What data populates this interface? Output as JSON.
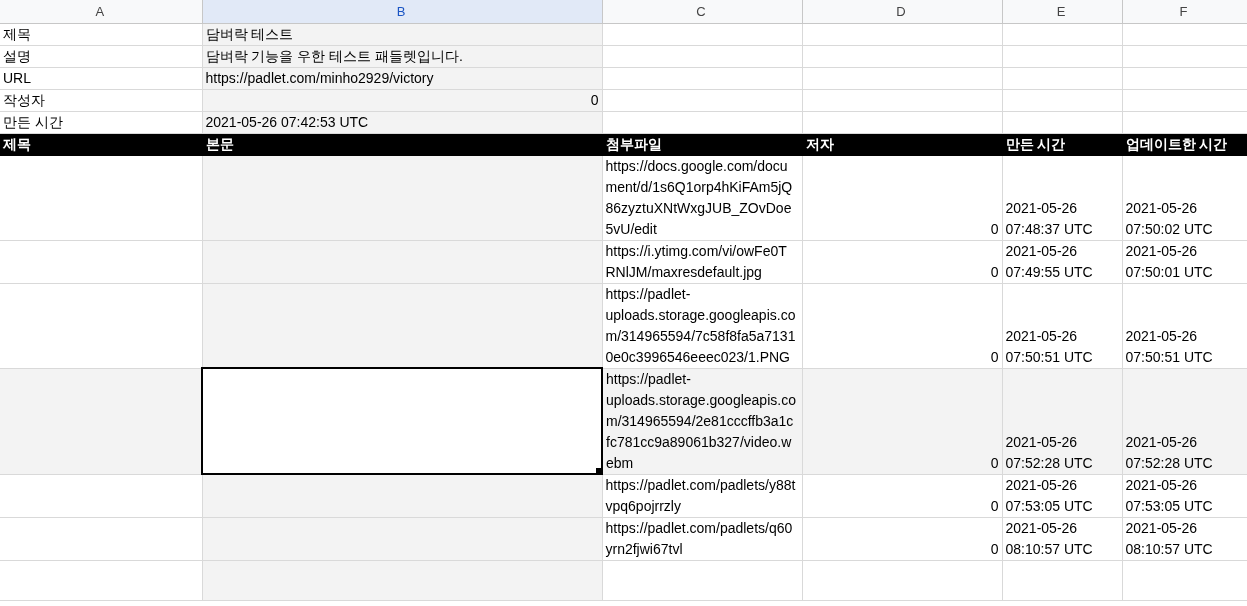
{
  "column_headers": [
    {
      "label": "A",
      "selected": false
    },
    {
      "label": "B",
      "selected": true
    },
    {
      "label": "C",
      "selected": false
    },
    {
      "label": "D",
      "selected": false
    },
    {
      "label": "E",
      "selected": false
    },
    {
      "label": "F",
      "selected": false
    }
  ],
  "meta_rows": [
    {
      "label": "제목",
      "value": "담벼락 테스트",
      "kind": "text"
    },
    {
      "label": "설명",
      "value": "담벼락 기능을 우한 테스트 패들렛입니다.",
      "kind": "text"
    },
    {
      "label": "URL",
      "value": "https://padlet.com/minho2929/victory",
      "kind": "text"
    },
    {
      "label": "작성자",
      "value": "0",
      "kind": "number"
    },
    {
      "label": "만든 시간",
      "value": "2021-05-26 07:42:53 UTC",
      "kind": "text"
    }
  ],
  "table": {
    "columns": [
      "제목",
      "본문",
      "첨부파일",
      "저자",
      "만든 시간",
      "업데이트한 시간"
    ],
    "rows": [
      {
        "attachment": "https://docs.google.com/document/d/1s6Q1orp4hKiFAm5jQ86zyztuXNtWxgJUB_ZOvDoe5vU/edit",
        "author": "0",
        "created": "2021-05-26 07:48:37 UTC",
        "updated": "2021-05-26 07:50:02 UTC",
        "selected": false
      },
      {
        "attachment": "https://i.ytimg.com/vi/owFe0TRNlJM/maxresdefault.jpg",
        "author": "0",
        "created": "2021-05-26 07:49:55 UTC",
        "updated": "2021-05-26 07:50:01 UTC",
        "selected": false
      },
      {
        "attachment": "https://padlet-uploads.storage.googleapis.com/314965594/7c58f8fa5a71310e0c3996546eeec023/1.PNG",
        "author": "0",
        "created": "2021-05-26 07:50:51 UTC",
        "updated": "2021-05-26 07:50:51 UTC",
        "selected": false
      },
      {
        "attachment": "https://padlet-uploads.storage.googleapis.com/314965594/2e81cccffb3a1cfc781cc9a89061b327/video.webm",
        "author": "0",
        "created": "2021-05-26 07:52:28 UTC",
        "updated": "2021-05-26 07:52:28 UTC",
        "selected": true
      },
      {
        "attachment": "https://padlet.com/padlets/y88tvpq6pojrrzly",
        "author": "0",
        "created": "2021-05-26 07:53:05 UTC",
        "updated": "2021-05-26 07:53:05 UTC",
        "selected": false
      },
      {
        "attachment": "https://padlet.com/padlets/q60yrn2fjwi67tvl",
        "author": "0",
        "created": "2021-05-26 08:10:57 UTC",
        "updated": "2021-05-26 08:10:57 UTC",
        "selected": false
      }
    ]
  }
}
